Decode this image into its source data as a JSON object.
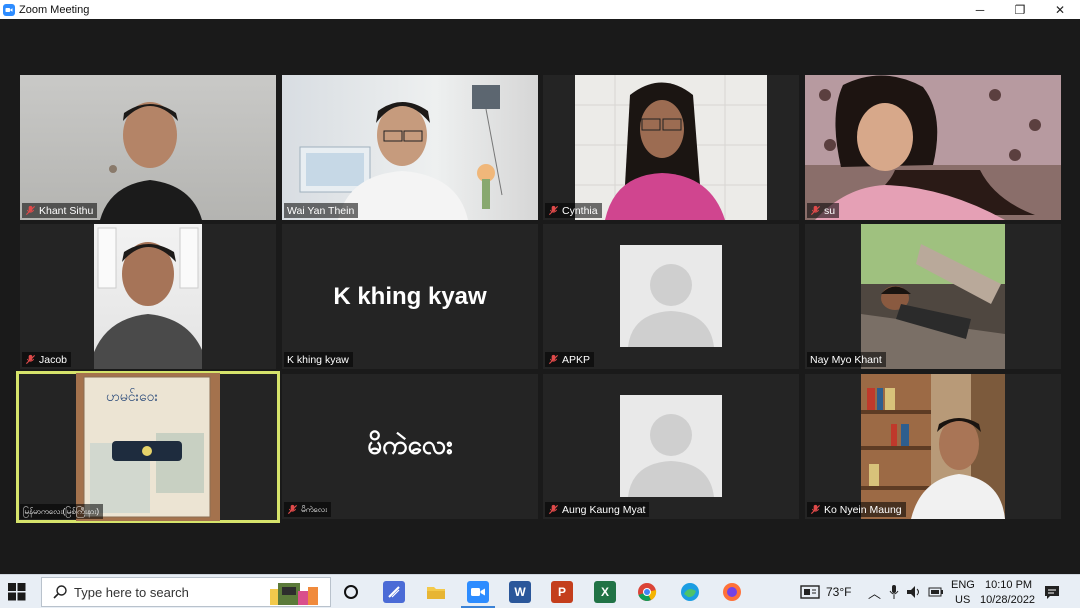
{
  "window": {
    "title": "Zoom Meeting",
    "minimize": "─",
    "maximize": "❐",
    "close": "✕"
  },
  "participants": [
    {
      "name": "Khant Sithu",
      "muted": true
    },
    {
      "name": "Wai Yan Thein",
      "muted": false
    },
    {
      "name": "Cynthia",
      "muted": true
    },
    {
      "name": "su",
      "muted": true
    },
    {
      "name": "Jacob",
      "muted": true
    },
    {
      "name": "K khing kyaw",
      "muted": false,
      "display_text": "K khing kyaw"
    },
    {
      "name": "APKP",
      "muted": true
    },
    {
      "name": "Nay Myo Khant",
      "muted": false
    },
    {
      "name": "မြန်မာကလေး(မြစ်ကြီးနား)",
      "muted": false
    },
    {
      "name": "မိကဲလေး",
      "muted": true,
      "display_text": "မိကဲလေး"
    },
    {
      "name": "Aung Kaung Myat",
      "muted": true
    },
    {
      "name": "Ko Nyein Maung",
      "muted": true
    }
  ],
  "taskbar": {
    "search_placeholder": "Type here to search",
    "weather": "73°F",
    "language": "ENG",
    "region": "US",
    "time": "10:10 PM",
    "date": "10/28/2022"
  },
  "colors": {
    "active_speaker_border": "#d6e36b",
    "muted_icon": "#e04a4a",
    "zoom_blue": "#2d8cff"
  }
}
